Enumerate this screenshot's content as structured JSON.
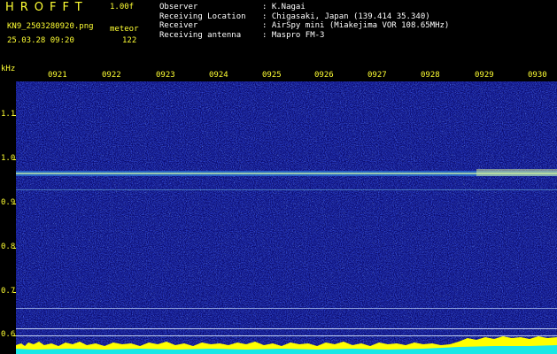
{
  "header": {
    "brand": "HROFFT",
    "version": "1.00f",
    "filename": "KN9_2503280920.png",
    "mode": "meteor",
    "datetime": "25.03.28 09:20",
    "count": "122"
  },
  "metadata": [
    {
      "label": "Observer",
      "value": "K.Nagai"
    },
    {
      "label": "Receiving Location",
      "value": "Chigasaki, Japan (139.414 35.340)"
    },
    {
      "label": "Receiver",
      "value": "AirSpy mini (Miakejima VOR 108.65MHz)"
    },
    {
      "label": "Receiving antenna",
      "value": "Maspro FM-3"
    }
  ],
  "axis": {
    "y_unit": "kHz",
    "y_ticks": [
      "1.1",
      "1.0",
      "0.9",
      "0.8",
      "0.7",
      "0.6"
    ],
    "x_ticks": [
      "0921",
      "0922",
      "0923",
      "0924",
      "0925",
      "0926",
      "0927",
      "0928",
      "0929",
      "0930"
    ]
  },
  "colors": {
    "label": "#ffff33",
    "background": "#000000",
    "spectrum_base": "#0a0a6e"
  }
}
